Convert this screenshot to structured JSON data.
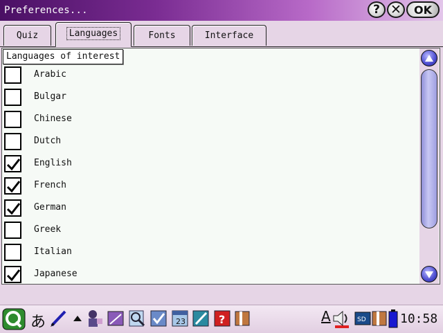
{
  "window": {
    "title": "Preferences...",
    "help_label": "?",
    "close_label": "✕",
    "ok_label": "OK"
  },
  "tabs": [
    {
      "label": "Quiz",
      "active": false
    },
    {
      "label": "Languages",
      "active": true
    },
    {
      "label": "Fonts",
      "active": false
    },
    {
      "label": "Interface",
      "active": false
    }
  ],
  "group": {
    "label": "Languages of interest"
  },
  "languages": [
    {
      "label": "Arabic",
      "checked": false
    },
    {
      "label": "Bulgar",
      "checked": false
    },
    {
      "label": "Chinese",
      "checked": false
    },
    {
      "label": "Dutch",
      "checked": false
    },
    {
      "label": "English",
      "checked": true
    },
    {
      "label": "French",
      "checked": true
    },
    {
      "label": "German",
      "checked": true
    },
    {
      "label": "Greek",
      "checked": false
    },
    {
      "label": "Italian",
      "checked": false
    },
    {
      "label": "Japanese",
      "checked": true
    }
  ],
  "scrollbar": {
    "position_fraction": 0.0,
    "up_icon": "arrow-up-icon",
    "down_icon": "arrow-down-icon"
  },
  "taskbar": {
    "ime_label": "あ",
    "text_tool_label": "A",
    "clock": "10:58",
    "icons": [
      "qtopia-start-icon",
      "input-method-icon",
      "pen-icon",
      "arrow-up-icon",
      "user-icon",
      "notepad-icon",
      "search-icon",
      "checklist-icon",
      "calendar-icon",
      "drawing-icon",
      "help-icon",
      "book-icon",
      "text-tool-icon",
      "volume-icon",
      "sd-card-icon",
      "book-icon",
      "battery-icon"
    ],
    "colors": {
      "battery": "#1818d0",
      "text_tool_bar": "#e02020"
    }
  },
  "colors": {
    "titlebar_start": "#4a1064",
    "titlebar_end": "#e3c6ea",
    "background": "#e6d5e6",
    "list_bg": "#f6faf6"
  }
}
